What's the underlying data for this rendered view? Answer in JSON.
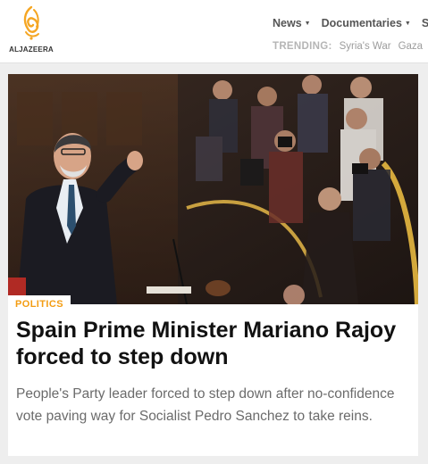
{
  "brand": {
    "name": "ALJAZEERA",
    "logo_color": "#f5a623"
  },
  "nav": {
    "items": [
      {
        "label": "News",
        "icon": "chevron-down-icon"
      },
      {
        "label": "Documentaries",
        "icon": "chevron-down-icon"
      },
      {
        "label": "Sh"
      }
    ]
  },
  "trending": {
    "label": "TRENDING:",
    "links": [
      "Syria's War",
      "Gaza"
    ]
  },
  "article": {
    "category": "POLITICS",
    "category_color": "#f39c12",
    "headline": "Spain Prime Minister Mariano Rajoy forced to step down",
    "summary": "People's Party leader forced to step down after no-confidence vote paving way for Socialist Pedro Sanchez to take reins."
  }
}
